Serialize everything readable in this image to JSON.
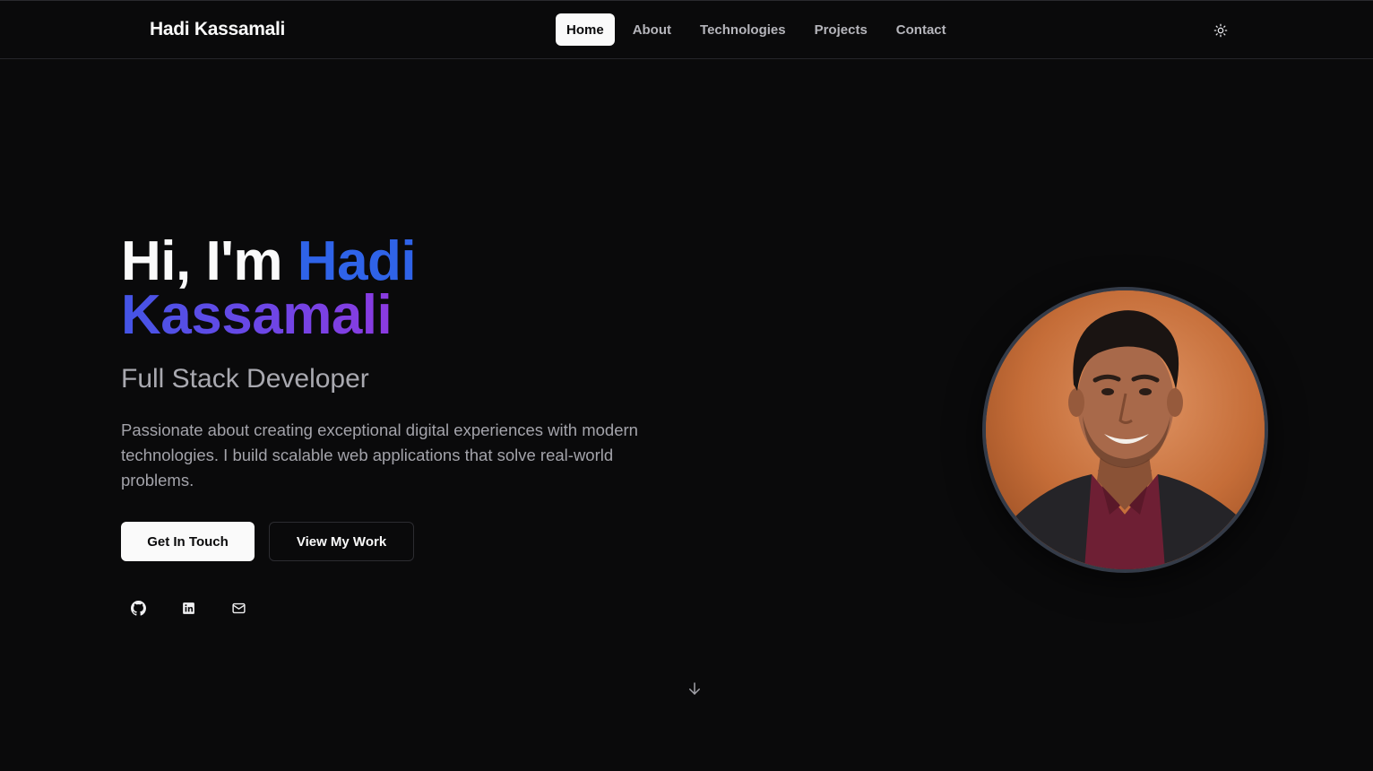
{
  "nav": {
    "brand": "Hadi Kassamali",
    "links": [
      "Home",
      "About",
      "Technologies",
      "Projects",
      "Contact"
    ],
    "active": "Home",
    "theme_toggle_icon": "sun-icon"
  },
  "hero": {
    "greeting": "Hi, I'm",
    "first_name": "Hadi",
    "last_name": "Kassamali",
    "subtitle": "Full Stack Developer",
    "description": "Passionate about creating exceptional digital experiences with modern technologies. I build scalable web applications that solve real-world problems.",
    "primary_button": "Get In Touch",
    "secondary_button": "View My Work",
    "socials": [
      {
        "name": "github-icon"
      },
      {
        "name": "linkedin-icon"
      },
      {
        "name": "mail-icon"
      }
    ],
    "scroll_icon": "arrow-down-icon"
  },
  "colors": {
    "background": "#0a0a0b",
    "accent_blue": "#2f63e8",
    "accent_purple": "#9138e0"
  }
}
